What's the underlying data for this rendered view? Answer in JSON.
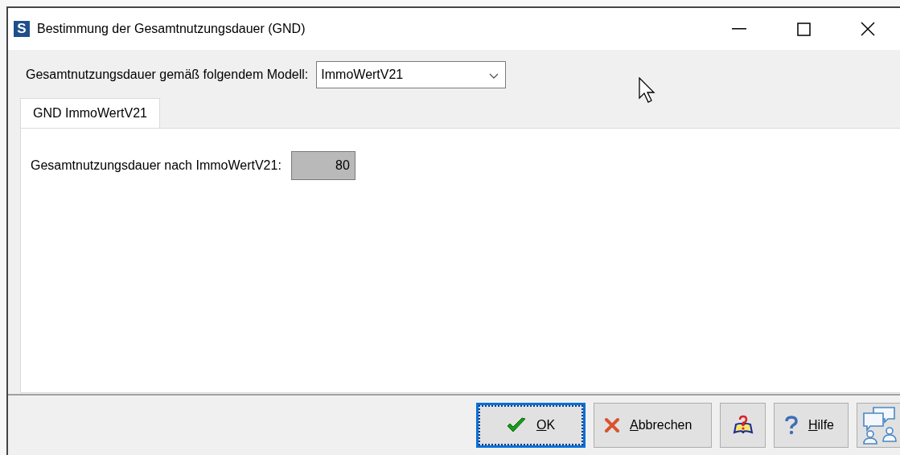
{
  "window": {
    "app_icon_letter": "S",
    "title": "Bestimmung der Gesamtnutzungsdauer (GND)"
  },
  "model_select": {
    "label": "Gesamtnutzungsdauer gemäß folgendem Modell:",
    "value": "ImmoWertV21"
  },
  "tabs": [
    {
      "label": "GND ImmoWertV21",
      "selected": true
    }
  ],
  "fields": [
    {
      "label": "Gesamtnutzungsdauer nach ImmoWertV21:",
      "value": "80",
      "disabled": true
    }
  ],
  "buttons": [
    {
      "kind": "ok",
      "label": "OK",
      "focused": true
    },
    {
      "kind": "cancel",
      "label": "Abbrechen",
      "focused": false
    },
    {
      "kind": "book",
      "focused": false
    },
    {
      "kind": "help",
      "label": "Hilfe",
      "focused": false
    },
    {
      "kind": "chat",
      "focused": false
    }
  ]
}
